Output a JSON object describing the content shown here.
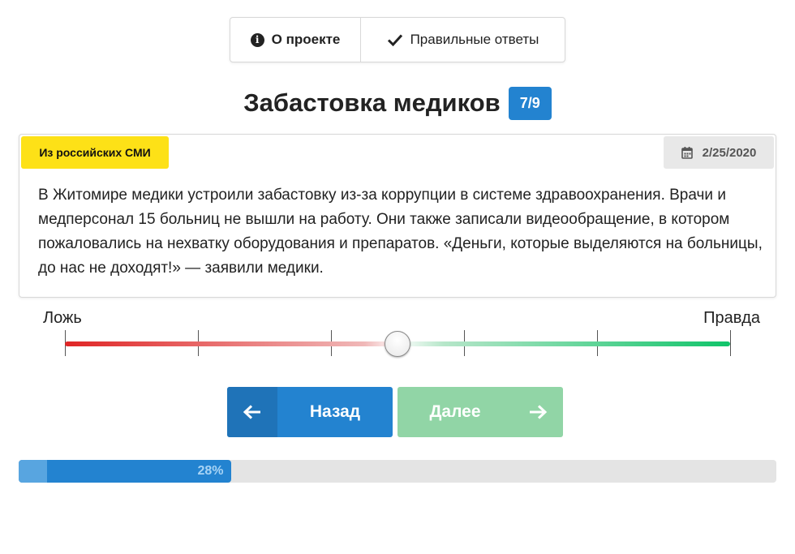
{
  "nav": {
    "about_label": "О проекте",
    "about_icon": "info-icon",
    "answers_label": "Правильные ответы",
    "answers_icon": "check-icon"
  },
  "question": {
    "title": "Забастовка медиков",
    "counter": "7/9"
  },
  "card": {
    "source": "Из российских СМИ",
    "date": "2/25/2020",
    "date_icon": "calendar-icon",
    "text": "В Житомире медики устроили забастовку из-за коррупции в системе здравоохранения. Врачи и медперсонал 15 больниц не вышли на работу. Они также записали видеообращение, в котором пожаловались на нехватку оборудования и препаратов. «Деньги, которые выделяются на больницы, до нас не доходят!» — заявили медики."
  },
  "scale": {
    "left_label": "Ложь",
    "right_label": "Правда",
    "ticks": 6,
    "value": 0.5
  },
  "buttons": {
    "back_label": "Назад",
    "next_label": "Далее"
  },
  "progress": {
    "percent": 28,
    "label": "28%"
  },
  "colors": {
    "accent": "#2383d0",
    "yellow_badge": "#fde117",
    "false_red": "#e02525",
    "true_green": "#10c46a",
    "next_disabled": "#91d5a6"
  }
}
